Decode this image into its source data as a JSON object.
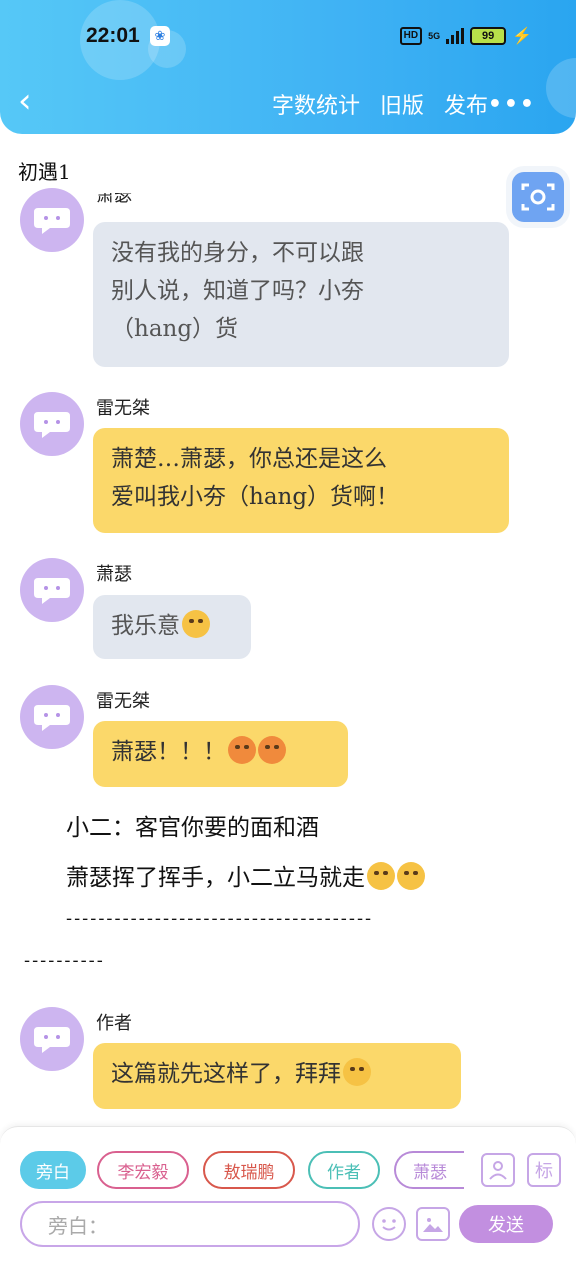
{
  "status_bar": {
    "time": "22:01",
    "hd": "HD",
    "network": "5G",
    "battery": "99"
  },
  "header": {
    "back_glyph": "‹",
    "actions": [
      "字数统计",
      "旧版",
      "发布"
    ],
    "more_glyph": "•••"
  },
  "chapter_title": "初遇1",
  "messages": [
    {
      "speaker": "萧瑟",
      "style": "gray",
      "lines": [
        "没有我的身分，不可以跟",
        "别人说，知道了吗？小夯",
        "（hang）货"
      ]
    },
    {
      "speaker": "雷无桀",
      "style": "yellow",
      "lines": [
        "萧楚…萧瑟，你总还是这么",
        "爱叫我小夯（hang）货啊！"
      ]
    },
    {
      "speaker": "萧瑟",
      "style": "gray",
      "text": "我乐意",
      "emoji": "smirk"
    },
    {
      "speaker": "雷无桀",
      "style": "yellow",
      "text": "萧瑟！！！",
      "emoji": "angry-angry"
    }
  ],
  "narration": {
    "line1": "小二：客官你要的面和酒",
    "line2": "萧瑟挥了挥手，小二立马就走",
    "dash1": "--------------------------------------",
    "dash2": "----------"
  },
  "author_message": {
    "speaker": "作者",
    "text": "这篇就先这样了，拜拜",
    "emoji": "kiss"
  },
  "character_chips": [
    {
      "label": "旁白",
      "color": "#5ccbe8",
      "selected": true
    },
    {
      "label": "李宏毅",
      "color": "#d9608f",
      "selected": false
    },
    {
      "label": "敖瑞鹏",
      "color": "#d8584c",
      "selected": false
    },
    {
      "label": "作者",
      "color": "#4bbfb6",
      "selected": false
    },
    {
      "label": "萧瑟",
      "color": "#b88ad8",
      "selected": false
    }
  ],
  "tools": {
    "tag_label": "标"
  },
  "input": {
    "placeholder": "旁白："
  },
  "send_label": "发送"
}
